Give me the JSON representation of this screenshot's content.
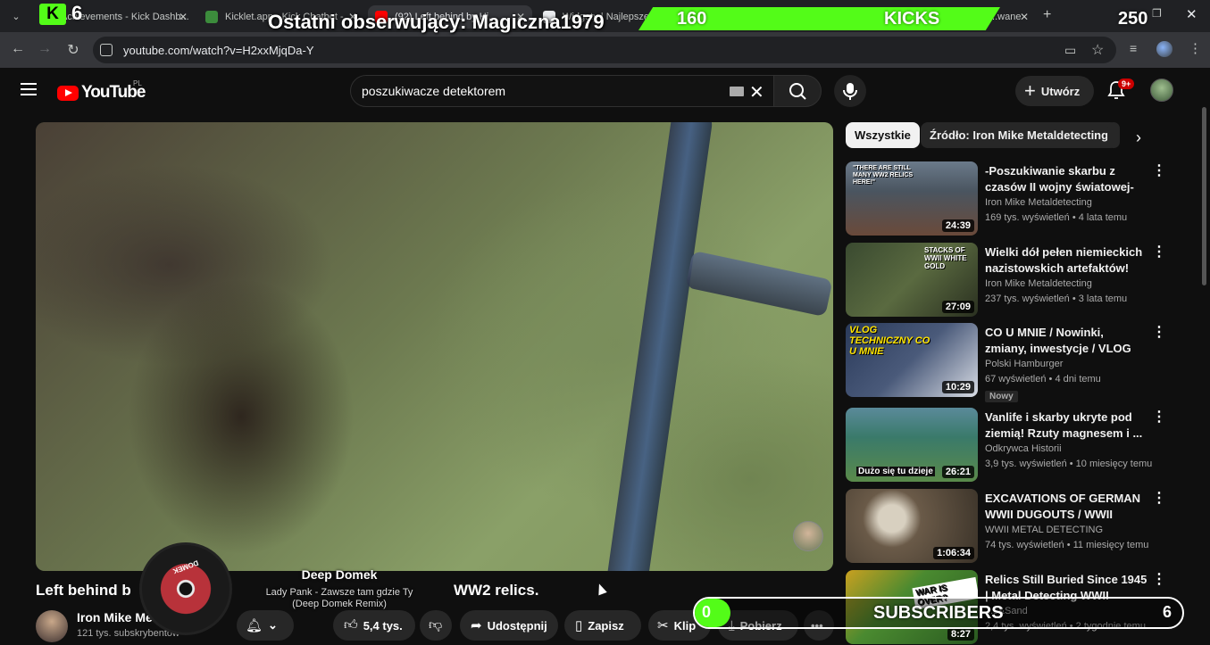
{
  "browser": {
    "tabs": [
      {
        "label": "Achievements - Kick Dashb...",
        "active": false,
        "fav_color": "#53fc18"
      },
      {
        "label": "Kicklet.app - Kick Chatbot -",
        "active": false,
        "fav_color": "#3c8c3c"
      },
      {
        "label": "(92) Left behind by Hi...",
        "active": true,
        "fav_color": "#ff0000"
      },
      {
        "label": "Widgety | Najlepsze op...",
        "active": false,
        "fav_color": "#e8eaed"
      },
      {
        "label": "...wane",
        "active": false,
        "fav_color": "#888888"
      }
    ],
    "new_tab": "+",
    "url": "youtube.com/watch?v=H2xxMjqDa-Y"
  },
  "stream_overlay": {
    "kick_logo": "K",
    "kick_number": "6",
    "last_follower": "Ostatni obserwujący: Magiczna1979",
    "kicks_count": "160",
    "kicks_label": "KICKS",
    "kicks_goal": "250",
    "music_title": "Deep Domek",
    "music_subtitle": "Lady Pank - Zawsze tam gdzie Ty (Deep Domek Remix)",
    "music_disc_label": "DOMEK",
    "subscribers_count": "0",
    "subscribers_label": "SUBSCRIBERS",
    "subscribers_goal": "6",
    "accent": "#53fc18"
  },
  "youtube": {
    "logo_text": "YouTube",
    "country": "PL",
    "search_query": "poszukiwacze detektorem",
    "create_label": "Utwórz",
    "notifications_badge": "9+"
  },
  "video": {
    "title_start": "Left behind b",
    "title_end": "WW2 relics.",
    "channel_name": "Iron Mike Me",
    "channel_subs": "121 tys. subskrybentów",
    "likes": "5,4 tys.",
    "share_label": "Udostępnij",
    "save_label": "Zapisz",
    "clip_label": "Klip",
    "download_label": "Pobierz"
  },
  "sidebar": {
    "chips": [
      "Wszystkie",
      "Źródło: Iron Mike Metaldetecting"
    ],
    "recommendations": [
      {
        "title": "-Poszukiwanie skarbu z czasów II wojny światowej-najbardziej ...",
        "channel": "Iron Mike Metaldetecting",
        "meta": "169 tys. wyświetleń • 4 lata temu",
        "duration": "24:39",
        "thumb_text": "\"THERE ARE STILL MANY WW2 RELICS HERE!\"",
        "badge": ""
      },
      {
        "title": "Wielki dół pełen niemieckich nazistowskich artefaktów!",
        "channel": "Iron Mike Metaldetecting",
        "meta": "237 tys. wyświetleń • 3 lata temu",
        "duration": "27:09",
        "thumb_text": "STACKS OF WWII WHITE GOLD",
        "badge": ""
      },
      {
        "title": "CO U MNIE / Nowinki, zmiany, inwestycje / VLOG techniczny",
        "channel": "Polski Hamburger",
        "meta": "67 wyświetleń • 4 dni temu",
        "duration": "10:29",
        "thumb_text": "VLOG TECHNICZNY CO U MNIE",
        "badge": "Nowy"
      },
      {
        "title": "Vanlife i skarby ukryte pod ziemią! Rzuty magnesem i ...",
        "channel": "Odkrywca Historii",
        "meta": "3,9 tys. wyświetleń • 10 miesięcy temu",
        "duration": "26:21",
        "thumb_text": "Dużo się tu dzieje",
        "badge": ""
      },
      {
        "title": "EXCAVATIONS OF GERMAN WWII DUGOUTS / WWII META...",
        "channel": "WWII METAL DETECTING",
        "meta": "74 tys. wyświetleń • 11 miesięcy temu",
        "duration": "1:06:34",
        "thumb_text": "",
        "badge": ""
      },
      {
        "title": "Relics Still Buried Since 1945 | Metal Detecting WWII",
        "channel": "...s&Sand",
        "meta": "2,4 tys. wyświetleń • 2 tygodnie temu",
        "duration": "8:27",
        "thumb_text": "WAR IS OVER?",
        "badge": ""
      }
    ]
  }
}
